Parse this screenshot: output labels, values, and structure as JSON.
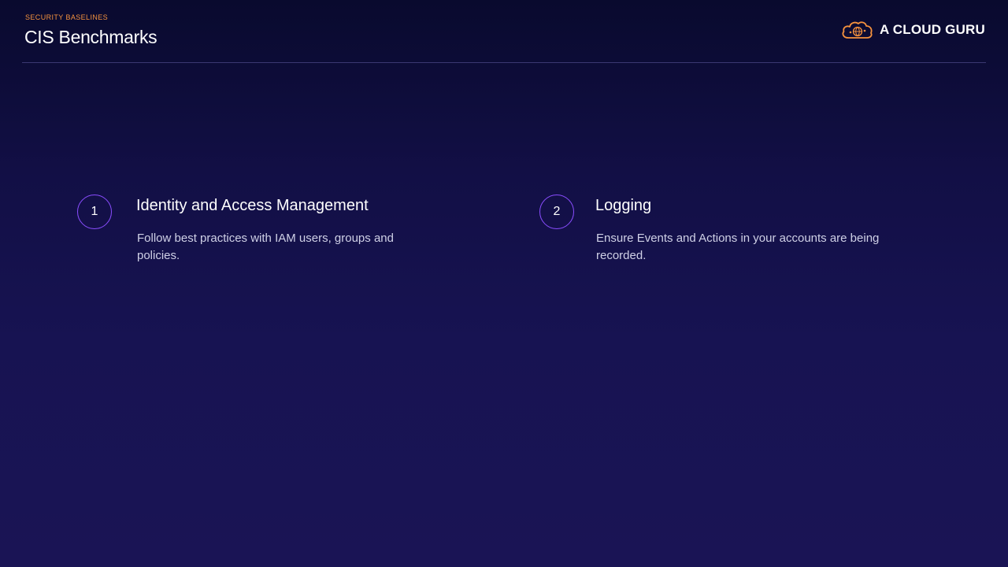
{
  "header": {
    "eyebrow": "SECURITY BASELINES",
    "title": "CIS Benchmarks"
  },
  "brand": {
    "name": "A CLOUD GURU",
    "icon": "cloud-logo-icon",
    "accent_color": "#f5923e"
  },
  "items": [
    {
      "number": "1",
      "title": "Identity and Access Management",
      "description": "Follow best practices with IAM users, groups and policies."
    },
    {
      "number": "2",
      "title": "Logging",
      "description": "Ensure Events and Actions in your accounts are being recorded."
    }
  ],
  "colors": {
    "background_top": "#090a2e",
    "background_bottom": "#1a1455",
    "circle_border": "#8a4dff",
    "eyebrow": "#f5923e"
  }
}
